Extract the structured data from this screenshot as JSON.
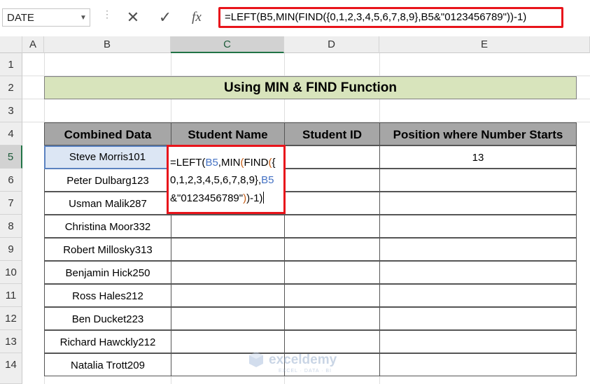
{
  "formula_bar": {
    "name_box": "DATE",
    "cancel_icon": "✕",
    "enter_icon": "✓",
    "fx_label": "fx",
    "formula": "=LEFT(B5,MIN(FIND({0,1,2,3,4,5,6,7,8,9},B5&\"0123456789\"))-1)"
  },
  "grid": {
    "columns": [
      "A",
      "B",
      "C",
      "D",
      "E"
    ],
    "rows": [
      "1",
      "2",
      "3",
      "4",
      "5",
      "6",
      "7",
      "8",
      "9",
      "10",
      "11",
      "12",
      "13",
      "14"
    ],
    "selected_column": "C",
    "selected_row": "5"
  },
  "sheet": {
    "title": "Using MIN & FIND Function",
    "headers": [
      "Combined Data",
      "Student Name",
      "Student ID",
      "Position where Number Starts"
    ],
    "combined_data": [
      "Steve Morris101",
      "Peter Dulbarg123",
      "Usman Malik287",
      "Christina Moor332",
      "Robert Millosky313",
      "Benjamin Hick250",
      "Ross Hales212",
      "Ben Ducket223",
      "Richard Hawckly212",
      "Natalia Trott209"
    ],
    "position_e5": "13"
  },
  "edit_cell": {
    "line1_a": "=LEFT(",
    "line1_ref": "B5",
    "line1_b": ",MIN",
    "line1_paren": "(",
    "line1_c": "FIND",
    "line1_paren2": "(",
    "line1_d": "{",
    "line2_a": "0,1,2,3,4,5,6,7,8,9},",
    "line2_ref": "B5",
    "line3_a": "&\"0123456789\"",
    "line3_paren": ")",
    "line3_b": ")-1)"
  },
  "watermark": {
    "brand": "exceldemy",
    "tagline": "EXCEL · DATA · BI"
  },
  "colors": {
    "title_fill": "#d8e4bc",
    "header_fill": "#a6a6a6",
    "highlight_red": "#e8141b",
    "active_border": "#5b82c0",
    "excel_green": "#217346"
  }
}
